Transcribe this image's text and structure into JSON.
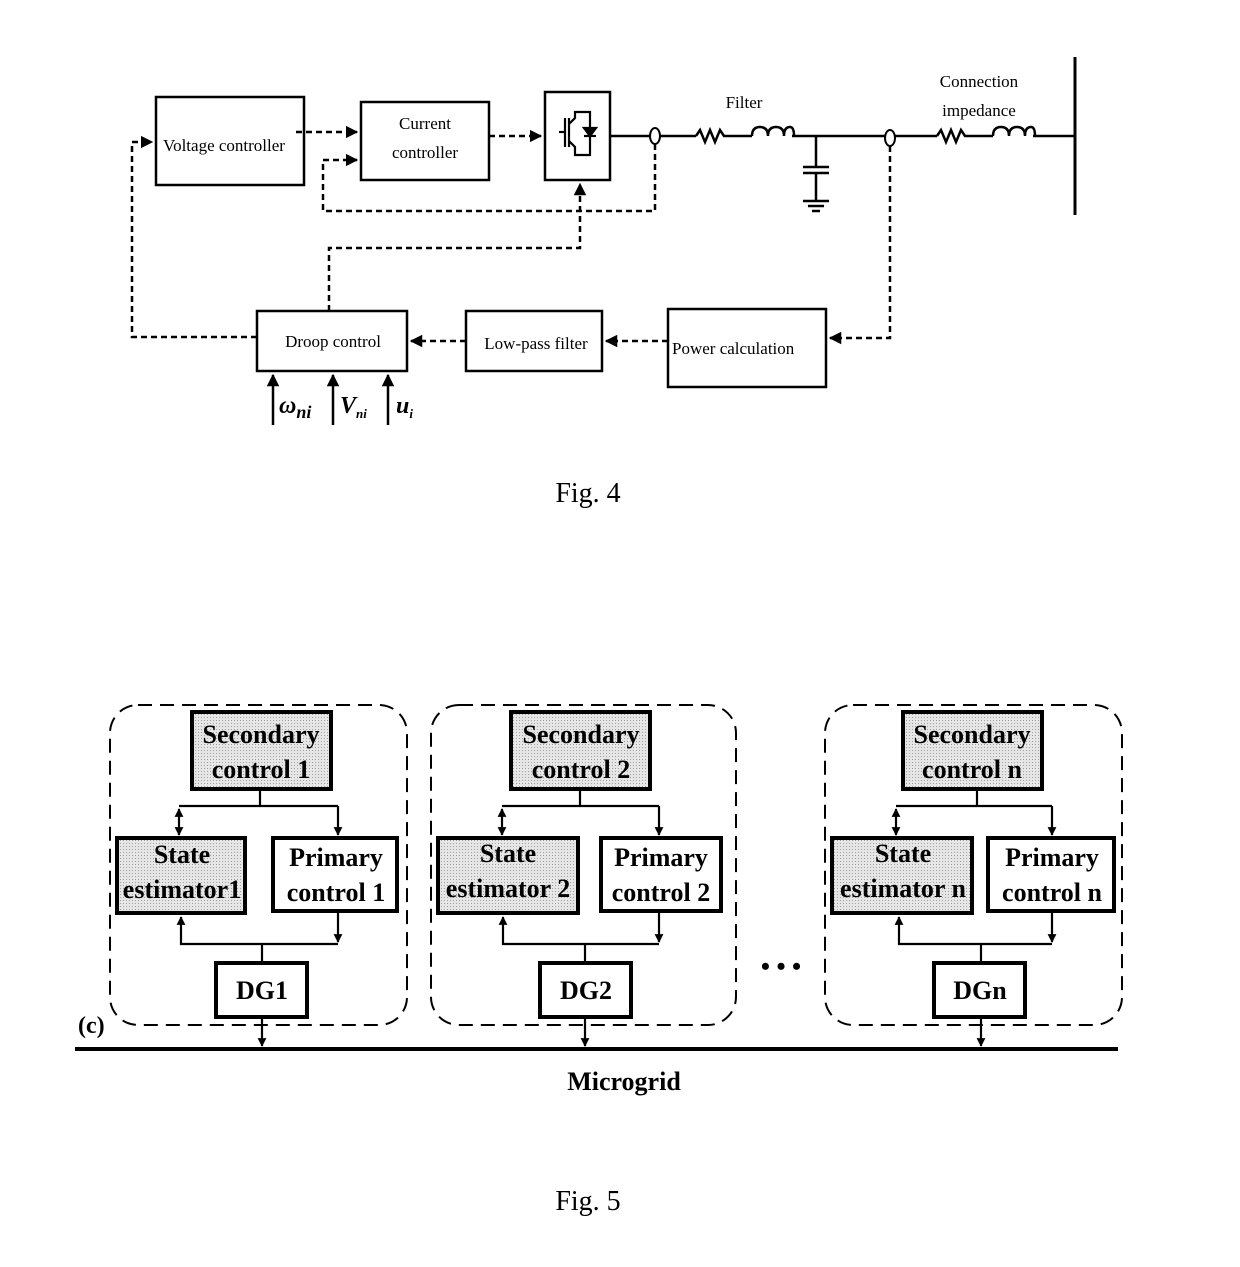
{
  "fig4": {
    "caption": "Fig. 4",
    "blocks": {
      "voltage_controller": "Voltage controller",
      "current_controller_line1": "Current",
      "current_controller_line2": "controller",
      "droop_control": "Droop control",
      "low_pass_filter": "Low-pass filter",
      "power_calculation": "Power calculation"
    },
    "labels": {
      "filter": "Filter",
      "connection_line1": "Connection",
      "connection_line2": "impedance"
    },
    "inputs": [
      {
        "symbol": "ω",
        "subscript": "ni"
      },
      {
        "symbol": "V",
        "subscript": "ni"
      },
      {
        "symbol": "u",
        "subscript": "i"
      }
    ]
  },
  "fig5": {
    "caption": "Fig. 5",
    "panel_label": "(c)",
    "bus_label": "Microgrid",
    "ellipsis": "• • •",
    "units": [
      {
        "secondary_line1": "Secondary",
        "secondary_line2": "control 1",
        "estimator_line1": "State",
        "estimator_line2": "estimator1",
        "primary_line1": "Primary",
        "primary_line2": "control 1",
        "dg": "DG1"
      },
      {
        "secondary_line1": "Secondary",
        "secondary_line2": "control 2",
        "estimator_line1": "State",
        "estimator_line2": "estimator 2",
        "primary_line1": "Primary",
        "primary_line2": "control 2",
        "dg": "DG2"
      },
      {
        "secondary_line1": "Secondary",
        "secondary_line2": "control n",
        "estimator_line1": "State",
        "estimator_line2": "estimator n",
        "primary_line1": "Primary",
        "primary_line2": "control n",
        "dg": "DGn"
      }
    ]
  }
}
